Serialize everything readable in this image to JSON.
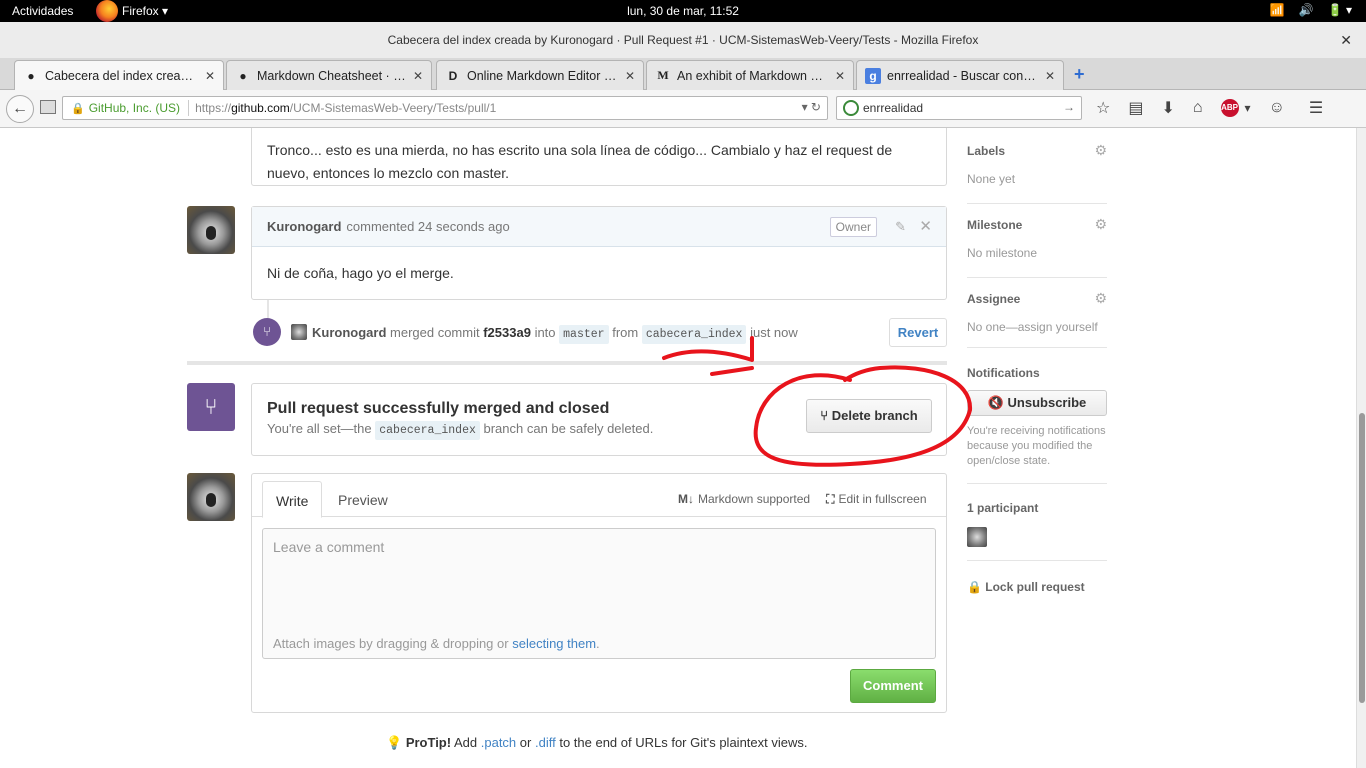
{
  "os_bar": {
    "activities": "Actividades",
    "app": "Firefox ▾",
    "clock": "lun, 30 de mar, 11:52",
    "tray": [
      "📶",
      "🔊",
      "🔋 ▾"
    ]
  },
  "window": {
    "title": "Cabecera del index creada by Kuronogard · Pull Request #1 · UCM-SistemasWeb-Veery/Tests - Mozilla Firefox",
    "close": "✕"
  },
  "tabs": [
    {
      "label": "Cabecera del index creada by Kuronogard",
      "icon": "github-icon",
      "glyph": "●"
    },
    {
      "label": "Markdown Cheatsheet · adam-p/markdown-here",
      "icon": "github-icon",
      "glyph": "●"
    },
    {
      "label": "Online Markdown Editor - Dillinger",
      "icon": "dillinger-icon",
      "glyph": "D"
    },
    {
      "label": "An exhibit of Markdown — Medium",
      "icon": "medium-icon",
      "glyph": "M"
    },
    {
      "label": "enrrealidad - Buscar con Google",
      "icon": "google-icon",
      "glyph": "g"
    }
  ],
  "tab_close": "✕",
  "new_tab": "+",
  "nav": {
    "back": "←",
    "identity": "GitHub, Inc. (US)",
    "url_proto": "https://",
    "url_host": "github.com",
    "url_path": "/UCM-SistemasWeb-Veery/Tests/pull/1",
    "url_tools": "▾ ↻",
    "search_value": "enrrealidad",
    "search_go": "→",
    "toolbar_icons": [
      "☆",
      "▤",
      "⬇",
      "⌂"
    ],
    "abp": "ABP",
    "extra_icons": [
      "▾",
      "☺",
      "☰"
    ]
  },
  "comment_prev": {
    "body": "Tronco... esto es una mierda, no has escrito una sola línea de código... Cambialo y haz el request de nuevo, entonces lo mezclo con master."
  },
  "comment_last": {
    "author": "Kuronogard",
    "meta": "commented 24 seconds ago",
    "role": "Owner",
    "body": "Ni de coña, hago yo el merge.",
    "edit": "✎",
    "delete": "✕"
  },
  "merge_event": {
    "badge": "⑂",
    "author": "Kuronogard",
    "t1": "merged commit",
    "sha": "f2533a9",
    "t2": "into",
    "base": "master",
    "t3": "from",
    "head": "cabecera_index",
    "t4": "just now",
    "revert": "Revert"
  },
  "merged": {
    "badge": "⑂",
    "title": "Pull request successfully merged and closed",
    "pre": "You're all set—the",
    "branch": "cabecera_index",
    "post": "branch can be safely deleted.",
    "delete_button": "⑂ Delete branch"
  },
  "new_comment": {
    "write": "Write",
    "preview": "Preview",
    "md_icon": "M↓",
    "md": "Markdown supported",
    "fs_icon": "⛶",
    "fs": "Edit in fullscreen",
    "placeholder": "Leave a comment",
    "attach_pre": "Attach images by dragging & dropping or",
    "attach_link": "selecting them",
    "attach_post": ".",
    "submit": "Comment"
  },
  "protip": {
    "icon": "💡",
    "label": "ProTip!",
    "t1": "Add",
    "patch": ".patch",
    "t2": "or",
    "diff": ".diff",
    "t3": "to the end of URLs for Git's plaintext views."
  },
  "sidebar": {
    "gear": "⚙",
    "labels_h": "Labels",
    "labels_v": "None yet",
    "milestone_h": "Milestone",
    "milestone_v": "No milestone",
    "assignee_h": "Assignee",
    "assignee_v": "No one—assign yourself",
    "notif_h": "Notifications",
    "unsub": "🔇 Unsubscribe",
    "notif_note": "You're receiving notifications because you modified the open/close state.",
    "part_h": "1 participant",
    "lock": "🔒 Lock pull request"
  },
  "colors": {
    "annotation": "#e8141c",
    "merged": "#6e5494",
    "link": "#4183c4",
    "green": "#60b044"
  }
}
